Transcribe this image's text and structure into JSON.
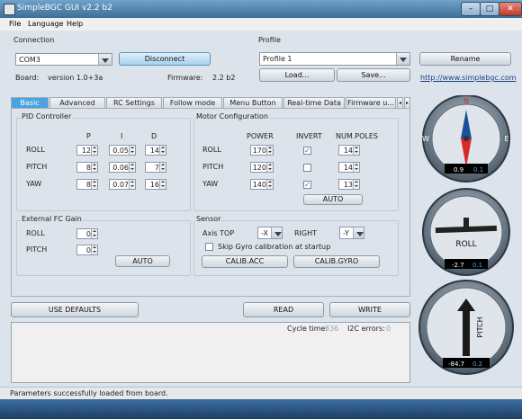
{
  "window": {
    "title": "SimpleBGC GUI v2.2 b2",
    "min_label": "–",
    "max_label": "□",
    "close_label": "✕"
  },
  "menu": [
    "File",
    "Language",
    "Help"
  ],
  "connection": {
    "section_label": "Connection",
    "port": "COM3",
    "disconnect_label": "Disconnect",
    "board_label": "Board:",
    "board_value": "version 1.0+3a",
    "firmware_label": "Firmware:",
    "firmware_value": "2.2 b2"
  },
  "profile": {
    "section_label": "Profile",
    "selected": "Profile 1",
    "rename_label": "Rename",
    "load_label": "Load...",
    "save_label": "Save...",
    "link": "http://www.simplebgc.com"
  },
  "tabs": [
    "Basic",
    "Advanced",
    "RC Settings",
    "Follow mode",
    "Menu Button",
    "Real-time Data",
    "Firmware u..."
  ],
  "pid": {
    "title": "PID Controller",
    "headers": [
      "P",
      "I",
      "D"
    ],
    "rows": [
      {
        "name": "ROLL",
        "p": "12",
        "i": "0.05",
        "d": "14"
      },
      {
        "name": "PITCH",
        "p": "8",
        "i": "0.06",
        "d": "7"
      },
      {
        "name": "YAW",
        "p": "8",
        "i": "0.07",
        "d": "16"
      }
    ]
  },
  "motor": {
    "title": "Motor Configuration",
    "headers": [
      "POWER",
      "INVERT",
      "NUM.POLES"
    ],
    "rows": [
      {
        "name": "ROLL",
        "power": "170",
        "invert": true,
        "poles": "14"
      },
      {
        "name": "PITCH",
        "power": "120",
        "invert": false,
        "poles": "14"
      },
      {
        "name": "YAW",
        "power": "140",
        "invert": true,
        "poles": "13"
      }
    ],
    "auto_label": "AUTO"
  },
  "extfc": {
    "title": "External FC Gain",
    "rows": [
      {
        "name": "ROLL",
        "value": "0"
      },
      {
        "name": "PITCH",
        "value": "0"
      }
    ],
    "auto_label": "AUTO"
  },
  "sensor": {
    "title": "Sensor",
    "axis_top_label": "Axis TOP",
    "axis_top_value": "-X",
    "right_label": "RIGHT",
    "right_value": "-Y",
    "skip_gyro_label": "Skip Gyro calibration at startup",
    "calib_acc_label": "CALIB.ACC",
    "calib_gyro_label": "CALIB.GYRO"
  },
  "actions": {
    "defaults_label": "USE DEFAULTS",
    "read_label": "READ",
    "write_label": "WRITE"
  },
  "console": {
    "cycle_label": "Cycle time:",
    "cycle_value": "836",
    "i2c_label": "I2C errors:",
    "i2c_value": "0"
  },
  "status_text": "Parameters successfully loaded from board.",
  "gauges": {
    "compass": {
      "n": "N",
      "w": "W",
      "e": "E",
      "value_a": "0.9",
      "value_b": "0.1"
    },
    "roll": {
      "label": "ROLL",
      "value_a": "-2.7",
      "value_b": "0.1"
    },
    "pitch": {
      "label": "PITCH",
      "value_a": "-84.7",
      "value_b": "0.2"
    }
  },
  "colors": {
    "accent": "#4aa3df",
    "title_bar": "#3e6e96"
  }
}
